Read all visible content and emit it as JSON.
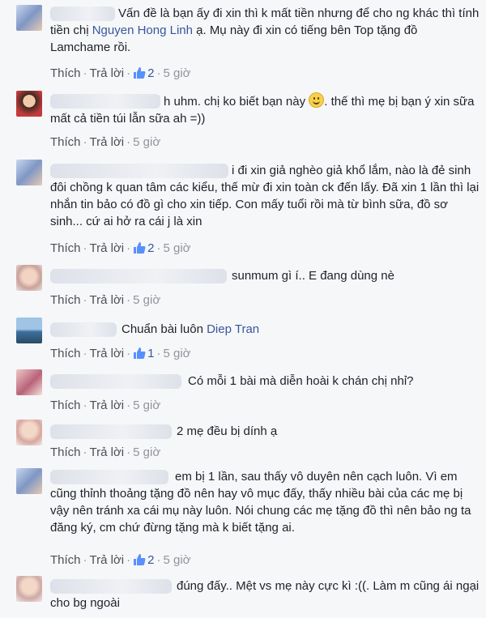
{
  "labels": {
    "like": "Thích",
    "reply": "Trả lời",
    "sep": "·"
  },
  "comments": [
    {
      "text_pre": "Vấn đề là bạn ấy đi xin thì k mất tiền nhưng để cho ng khác thì tính tiền chị ",
      "tag": "Nguyen Hong Linh",
      "text_post": " ạ. Mụ này đi xin có tiếng bên Top tặng đồ Lamchame rồi.",
      "likes": "2",
      "time": "5 giờ"
    },
    {
      "text_pre": "h uhm. chị ko biết bạn này ",
      "emoji": "smile-emoji",
      "text_post": ". thế thì mẹ bị bạn ý xin sữa mất cả tiền túi lẫn sữa ah =))",
      "time": "5 giờ"
    },
    {
      "text_pre": "i đi xin giả nghèo giả khổ lắm, nào là đẻ sinh đôi chồng k quan tâm các kiểu, thế mừ đi xin toàn ck đến lấy. Đã xin 1 lần thì lại nhắn tin bảo có đồ gì cho xin tiếp. Con mấy tuổi rồi mà từ bình sữa, đồ sơ sinh... cứ ai hở ra cái j là xin",
      "likes": "2",
      "time": "5 giờ"
    },
    {
      "text_pre": "sunmum gì í.. E đang dùng nè",
      "time": "5 giờ"
    },
    {
      "text_pre": "Chuẩn bài luôn ",
      "tag": "Diep Tran",
      "likes": "1",
      "time": "5 giờ"
    },
    {
      "text_pre": "Có mỗi 1 bài mà diễn hoài k chán chị nhỉ?",
      "time": "5 giờ"
    },
    {
      "text_pre": "2 mẹ đều bị dính ạ",
      "time": "5 giờ"
    },
    {
      "text_pre": "em bị 1 lần, sau thấy vô duyên nên cạch luôn. Vì em cũng thỉnh thoảng tặng đồ nên hay vô mục đấy, thấy nhiều bài của các mẹ bị vậy nên tránh xa cái mụ này luôn. Nói chung các mẹ tặng đồ thì nên bảo ng ta đăng ký, cm chứ đừng tặng mà k biết tặng ai.",
      "likes": "2",
      "time": "5 giờ"
    },
    {
      "text_pre": "đúng đấy.. Mệt vs mẹ này cực kì :((. Làm m cũng ái ngại cho bg ngoài"
    }
  ],
  "colors": {
    "link": "#365899",
    "meta": "#90949c",
    "background": "#f6f7f9"
  }
}
